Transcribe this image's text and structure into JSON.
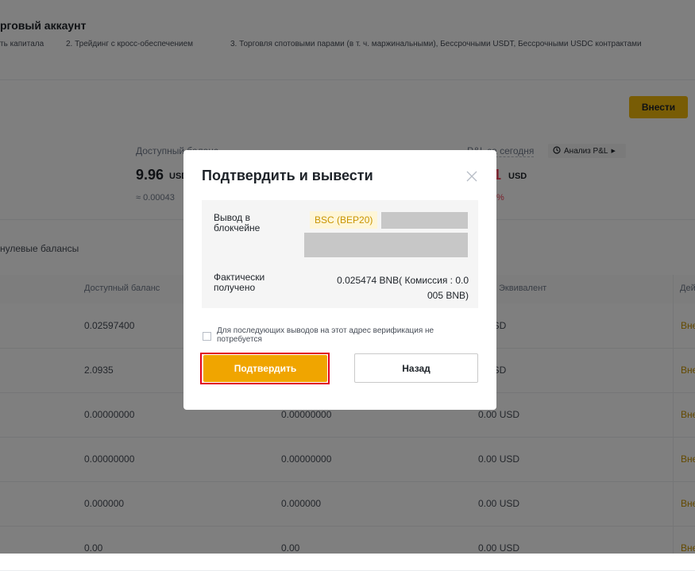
{
  "page": {
    "title": "рговый аккаунт",
    "tabs": [
      "ть капитала",
      "2. Трейдинг с кросс-обеспечением",
      "3. Торговля спотовыми парами (в т. ч. маржинальными), Бессрочными USDT, Бессрочными USDC контрактами"
    ],
    "deposit_button": "Внести",
    "available_balance_label": "Доступный баланс",
    "available_balance_value": "9.96",
    "available_balance_unit": "USD",
    "available_balance_approx": "≈ 0.00043",
    "pnl_label": "P&L за сегодня",
    "pnl_analysis_button": "Анализ P&L",
    "pnl_value": "1",
    "pnl_unit": "USD",
    "pnl_percent": "%",
    "hide_zero_label": "нулевые балансы"
  },
  "table": {
    "headers": [
      "Доступный баланс",
      "Эквивалент",
      "Дей"
    ],
    "rows": [
      {
        "available": "0.02597400",
        "middle": "",
        "equivalent": "7 USD",
        "action": "Вне"
      },
      {
        "available": "2.0935",
        "middle": "",
        "equivalent": "9 USD",
        "action": "Вне"
      },
      {
        "available": "0.00000000",
        "middle": "0.00000000",
        "equivalent": "0.00 USD",
        "action": "Вне"
      },
      {
        "available": "0.00000000",
        "middle": "0.00000000",
        "equivalent": "0.00 USD",
        "action": "Вне"
      },
      {
        "available": "0.000000",
        "middle": "0.000000",
        "equivalent": "0.00 USD",
        "action": "Вне"
      },
      {
        "available": "0.00",
        "middle": "0.00",
        "equivalent": "0.00 USD",
        "action": "Вне"
      }
    ]
  },
  "modal": {
    "title": "Подтвердить и вывести",
    "withdraw_label_line1": "Вывод в",
    "withdraw_label_line2": "блокчейне",
    "network_tag": "BSC (BEP20)",
    "received_label_line1": "Фактически",
    "received_label_line2": "получено",
    "received_line1": "0.025474 BNB( Комиссия : 0.0",
    "received_line2": "005 BNB)",
    "checkbox_line1": "Для последующих выводов на этот адрес верификация не",
    "checkbox_line2": "потребуется",
    "confirm_button": "Подтвердить",
    "back_button": "Назад"
  },
  "colors": {
    "accent": "#f0b90b",
    "confirm": "#f0a500",
    "highlight_border": "#e1001e",
    "negative": "#f6465d"
  }
}
